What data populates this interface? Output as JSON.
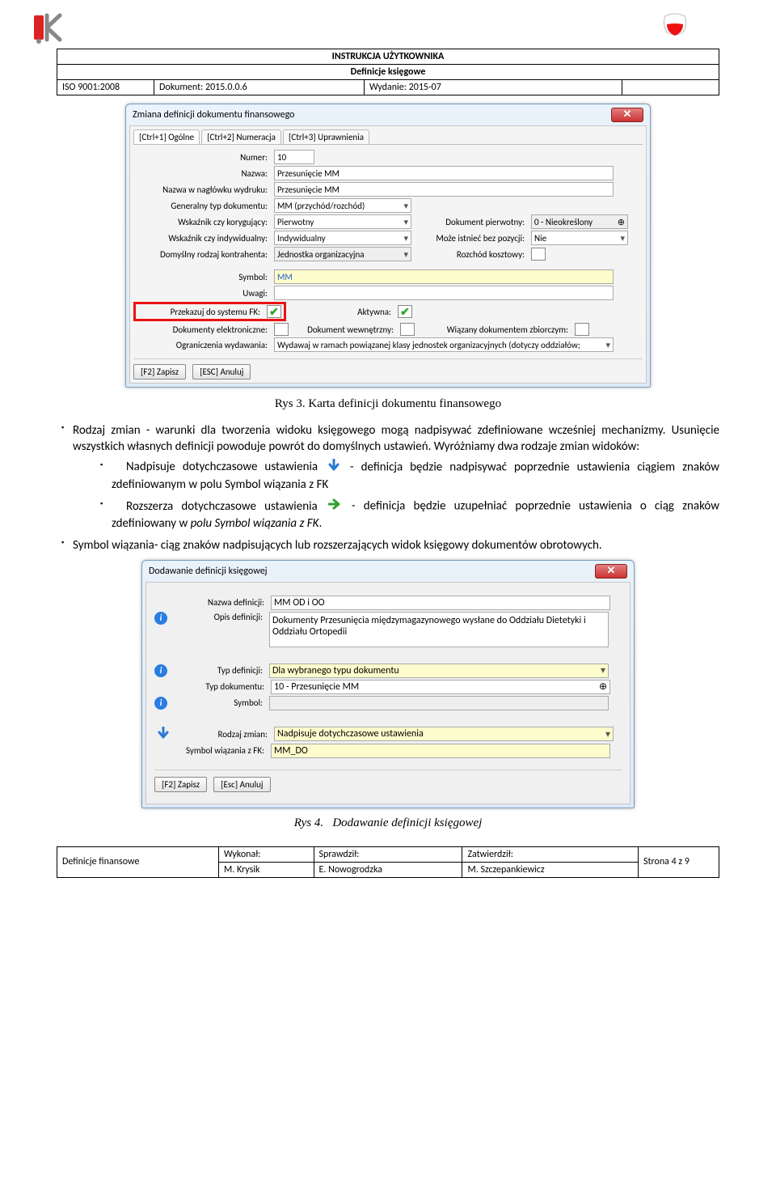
{
  "header": {
    "title": "INSTRUKCJA UŻYTKOWNIKA",
    "subtitle": "Definicje księgowe",
    "iso": "ISO 9001:2008",
    "dok": "Dokument: 2015.0.0.6",
    "wyd": "Wydanie: 2015-07"
  },
  "dialog1": {
    "title": "Zmiana definicji dokumentu finansowego",
    "tabs": [
      "[Ctrl+1] Ogólne",
      "[Ctrl+2] Numeracja",
      "[Ctrl+3] Uprawnienia"
    ],
    "labels": {
      "numer": "Numer:",
      "numer_v": "10",
      "nazwa": "Nazwa:",
      "nazwa_v": "Przesunięcie MM",
      "naglowek": "Nazwa w nagłówku wydruku:",
      "naglowek_v": "Przesunięcie MM",
      "gentyp": "Generalny typ dokumentu:",
      "gentyp_v": "MM (przychód/rozchód)",
      "koryg": "Wskaźnik czy korygujący:",
      "koryg_v": "Pierwotny",
      "dokpier": "Dokument pierwotny:",
      "dokpier_v": "0 - Nieokreślony",
      "indyw": "Wskaźnik czy indywidualny:",
      "indyw_v": "Indywidualny",
      "bezpoz": "Może istnieć bez pozycji:",
      "bezpoz_v": "Nie",
      "kontr": "Domyślny rodzaj kontrahenta:",
      "kontr_v": "Jednostka organizacyjna",
      "rozch": "Rozchód kosztowy:",
      "symbol": "Symbol:",
      "symbol_v": "MM",
      "uwagi": "Uwagi:",
      "fk": "Przekazuj do systemu FK:",
      "aktywna": "Aktywna:",
      "elektr": "Dokumenty elektroniczne:",
      "wewn": "Dokument wewnętrzny:",
      "zbior": "Wiązany dokumentem zbiorczym:",
      "ogran": "Ograniczenia wydawania:",
      "ogran_v": "Wydawaj w ramach powiązanej klasy jednostek organizacyjnych (dotyczy oddziałów;"
    },
    "btn_save": "[F2] Zapisz",
    "btn_cancel": "[ESC] Anuluj"
  },
  "fig3": "Rys 3.    Karta definicji dokumentu finansowego",
  "bullet1_a": "Rodzaj zmian - warunki dla tworzenia widoku księgowego mogą nadpisywać zdefiniowane wcześniej mechanizmy. Usunięcie wszystkich własnych definicji powoduje powrót do domyślnych ustawień. Wyróżniamy dwa rodzaje zmian widoków:",
  "sub1_label": "Nadpisuje dotychczasowe ustawienia",
  "sub1_text": " - definicja będzie nadpisywać poprzednie ustawienia ciągiem znaków zdefiniowanym w polu Symbol wiązania z FK",
  "sub2_label": "Rozszerza dotychczasowe ustawienia",
  "sub2_text_a": " - definicja będzie uzupełniać poprzednie ustawienia o ciąg znaków zdefiniowany w ",
  "sub2_text_b": "polu Symbol wiązania z FK",
  "bullet2": "Symbol wiązania- ciąg znaków nadpisujących lub rozszerzających widok księgowy dokumentów obrotowych.",
  "dialog2": {
    "title": "Dodawanie definicji księgowej",
    "nazwa": "Nazwa definicji:",
    "nazwa_v": "MM OD i OO",
    "opis": "Opis definicji:",
    "opis_v": "Dokumenty Przesunięcia międzymagazynowego wysłane do Oddziału Dietetyki i Oddziału Ortopedii",
    "typdef": "Typ definicji:",
    "typdef_v": "Dla wybranego typu dokumentu",
    "typdok": "Typ dokumentu:",
    "typdok_v": "10 - Przesunięcie MM",
    "symbol": "Symbol:",
    "rodz": "Rodzaj zmian:",
    "rodz_v": "Nadpisuje dotychczasowe ustawienia",
    "symfk": "Symbol wiązania z FK:",
    "symfk_v": "MM_DO",
    "btn_save": "[F2] Zapisz",
    "btn_cancel": "[Esc] Anuluj"
  },
  "fig4_a": "Rys 4.",
  "fig4_b": "Dodawanie definicji księgowej",
  "footer": {
    "col1": "Definicje finansowe",
    "wyk": "Wykonał:",
    "wyk_v": "M. Krysik",
    "spr": "Sprawdził:",
    "spr_v": "E. Nowogrodzka",
    "zat": "Zatwierdził:",
    "zat_v": "M. Szczepankiewicz",
    "page": "Strona 4 z 9"
  }
}
